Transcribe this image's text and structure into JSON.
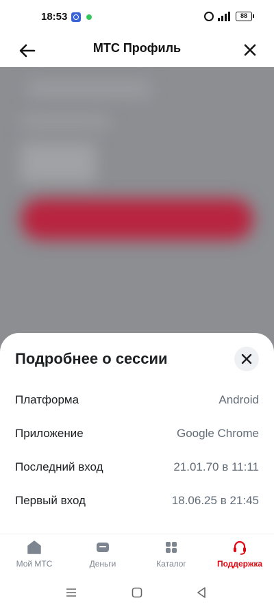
{
  "status_bar": {
    "time": "18:53",
    "battery": "88",
    "icons": [
      "app-notification-icon",
      "dot-notification-icon",
      "alarm-icon",
      "signal-icon",
      "battery-icon"
    ]
  },
  "app_bar": {
    "title": "МТС Профиль",
    "back_icon": "arrow-left-icon",
    "close_icon": "close-icon"
  },
  "sheet": {
    "title": "Подробнее о сессии",
    "close_icon": "close-icon",
    "rows": [
      {
        "label": "Платформа",
        "value": "Android"
      },
      {
        "label": "Приложение",
        "value": "Google Chrome"
      },
      {
        "label": "Последний вход",
        "value": "21.01.70 в 11:11"
      },
      {
        "label": "Первый вход",
        "value": "18.06.25 в 21:45"
      }
    ]
  },
  "bottom_nav": {
    "items": [
      {
        "label": "Мой МТС",
        "icon": "home-icon",
        "active": false
      },
      {
        "label": "Деньги",
        "icon": "wallet-icon",
        "active": false
      },
      {
        "label": "Каталог",
        "icon": "grid-icon",
        "active": false
      },
      {
        "label": "Поддержка",
        "icon": "headset-icon",
        "active": true
      }
    ]
  },
  "colors": {
    "accent": "#e30611",
    "text_primary": "#1d2023",
    "text_secondary": "#626c77",
    "overlay": "#8c8e92"
  },
  "system_nav": {
    "icons": [
      "menu-icon",
      "home-square-icon",
      "back-triangle-icon"
    ]
  }
}
